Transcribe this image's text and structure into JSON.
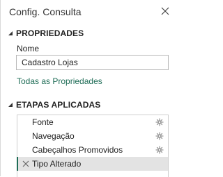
{
  "pane": {
    "title": "Config. Consulta",
    "close_icon": "close-icon"
  },
  "properties": {
    "section_title": "PROPRIEDADES",
    "toggle_icon": "triangle-down-icon",
    "name_label": "Nome",
    "name_value": "Cadastro Lojas",
    "all_properties_link": "Todas as Propriedades"
  },
  "applied_steps": {
    "section_title": "ETAPAS APLICADAS",
    "toggle_icon": "triangle-down-icon",
    "items": [
      {
        "label": "Fonte",
        "settings_icon": "gear-icon"
      },
      {
        "label": "Navegação",
        "settings_icon": "gear-icon"
      },
      {
        "label": "Cabeçalhos Promovidos",
        "settings_icon": "gear-icon"
      },
      {
        "label": "Tipo Alterado",
        "delete_icon": "close-icon",
        "selected": true
      }
    ]
  },
  "colors": {
    "link": "#1f6d57",
    "selected_row": "#e3e3e3",
    "border": "#cfcfcf",
    "icon": "#9a9a9a"
  }
}
